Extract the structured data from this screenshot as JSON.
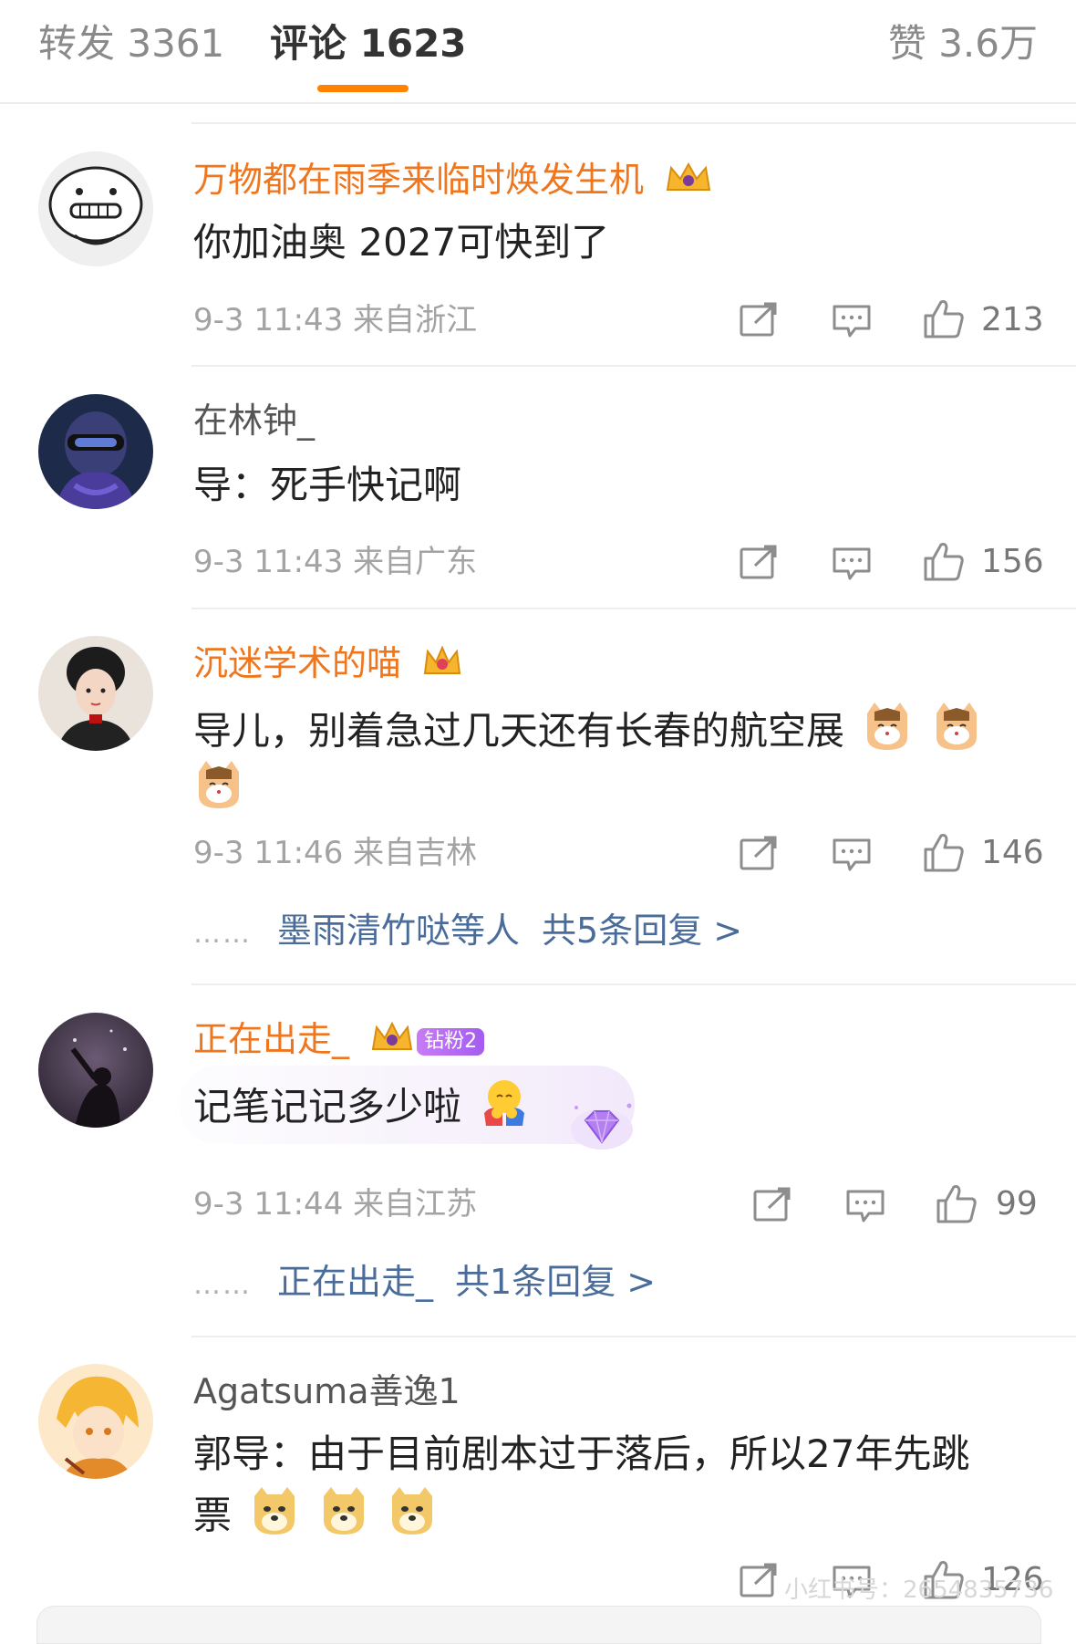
{
  "tabs": {
    "repost": "转发 3361",
    "comments": "评论 1623",
    "likes": "赞 3.6万"
  },
  "comments": [
    {
      "name": "万物都在雨季来临时焕发生机",
      "text": "你加油奥 2027可快到了",
      "meta": "9-3 11:43 来自浙江",
      "likes": "213"
    },
    {
      "name": "在林钟_",
      "text": "导：死手快记啊",
      "meta": "9-3 11:43 来自广东",
      "likes": "156"
    },
    {
      "name": "沉迷学术的喵",
      "text": "导儿，别着急过几天还有长春的航空展",
      "meta": "9-3 11:46 来自吉林",
      "likes": "146",
      "replies_user": "墨雨清竹哒等人",
      "replies_count": "共5条回复 >"
    },
    {
      "name": "正在出走_",
      "badge": "钻粉2",
      "text": "记笔记记多少啦",
      "meta": "9-3 11:44 来自江苏",
      "likes": "99",
      "replies_user": "正在出走_",
      "replies_count": "共1条回复 >"
    },
    {
      "name": "Agatsuma善逸1",
      "text_line1": "郭导：由于目前剧本过于落后，所以27年先跳",
      "text_line2": "票",
      "likes": "126"
    }
  ],
  "replies_dots": "……",
  "watermark": "小红书号：2654835736",
  "icons": [
    "repost-icon",
    "comment-icon",
    "like-icon",
    "crown-icon",
    "cat-emoji",
    "doge-emoji",
    "hug-emoji",
    "diamond-icon"
  ],
  "colors": {
    "accent": "#ff8200",
    "vip_name": "#f0761e",
    "reply_link": "#4a6c9b",
    "meta": "#a3a3a3"
  }
}
